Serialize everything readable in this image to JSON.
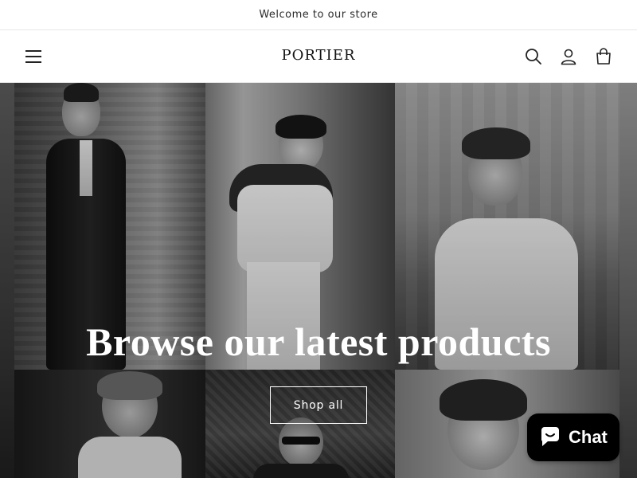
{
  "announcement": {
    "text": "Welcome to our store"
  },
  "header": {
    "logo": "PORTIER",
    "icons": [
      "menu-icon",
      "search-icon",
      "account-icon",
      "cart-icon"
    ]
  },
  "hero": {
    "title": "Browse our latest products",
    "cta_label": "Shop all",
    "tone": "black-and-white photo collage"
  },
  "chat": {
    "label": "Chat",
    "icon": "chat-bubble-icon"
  },
  "colors": {
    "text": "#121212",
    "hero_text": "#ffffff",
    "chat_bg": "#000000"
  }
}
